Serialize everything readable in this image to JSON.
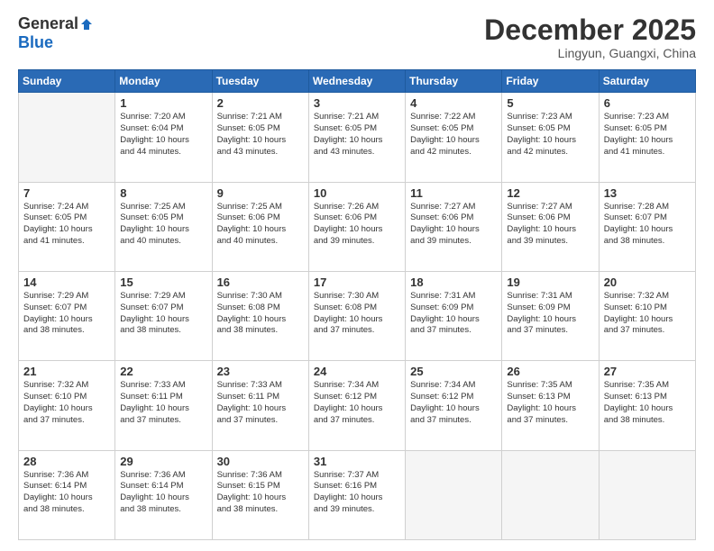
{
  "header": {
    "logo_general": "General",
    "logo_blue": "Blue",
    "month": "December 2025",
    "location": "Lingyun, Guangxi, China"
  },
  "weekdays": [
    "Sunday",
    "Monday",
    "Tuesday",
    "Wednesday",
    "Thursday",
    "Friday",
    "Saturday"
  ],
  "weeks": [
    [
      {
        "day": "",
        "info": ""
      },
      {
        "day": "1",
        "info": "Sunrise: 7:20 AM\nSunset: 6:04 PM\nDaylight: 10 hours\nand 44 minutes."
      },
      {
        "day": "2",
        "info": "Sunrise: 7:21 AM\nSunset: 6:05 PM\nDaylight: 10 hours\nand 43 minutes."
      },
      {
        "day": "3",
        "info": "Sunrise: 7:21 AM\nSunset: 6:05 PM\nDaylight: 10 hours\nand 43 minutes."
      },
      {
        "day": "4",
        "info": "Sunrise: 7:22 AM\nSunset: 6:05 PM\nDaylight: 10 hours\nand 42 minutes."
      },
      {
        "day": "5",
        "info": "Sunrise: 7:23 AM\nSunset: 6:05 PM\nDaylight: 10 hours\nand 42 minutes."
      },
      {
        "day": "6",
        "info": "Sunrise: 7:23 AM\nSunset: 6:05 PM\nDaylight: 10 hours\nand 41 minutes."
      }
    ],
    [
      {
        "day": "7",
        "info": "Sunrise: 7:24 AM\nSunset: 6:05 PM\nDaylight: 10 hours\nand 41 minutes."
      },
      {
        "day": "8",
        "info": "Sunrise: 7:25 AM\nSunset: 6:05 PM\nDaylight: 10 hours\nand 40 minutes."
      },
      {
        "day": "9",
        "info": "Sunrise: 7:25 AM\nSunset: 6:06 PM\nDaylight: 10 hours\nand 40 minutes."
      },
      {
        "day": "10",
        "info": "Sunrise: 7:26 AM\nSunset: 6:06 PM\nDaylight: 10 hours\nand 39 minutes."
      },
      {
        "day": "11",
        "info": "Sunrise: 7:27 AM\nSunset: 6:06 PM\nDaylight: 10 hours\nand 39 minutes."
      },
      {
        "day": "12",
        "info": "Sunrise: 7:27 AM\nSunset: 6:06 PM\nDaylight: 10 hours\nand 39 minutes."
      },
      {
        "day": "13",
        "info": "Sunrise: 7:28 AM\nSunset: 6:07 PM\nDaylight: 10 hours\nand 38 minutes."
      }
    ],
    [
      {
        "day": "14",
        "info": "Sunrise: 7:29 AM\nSunset: 6:07 PM\nDaylight: 10 hours\nand 38 minutes."
      },
      {
        "day": "15",
        "info": "Sunrise: 7:29 AM\nSunset: 6:07 PM\nDaylight: 10 hours\nand 38 minutes."
      },
      {
        "day": "16",
        "info": "Sunrise: 7:30 AM\nSunset: 6:08 PM\nDaylight: 10 hours\nand 38 minutes."
      },
      {
        "day": "17",
        "info": "Sunrise: 7:30 AM\nSunset: 6:08 PM\nDaylight: 10 hours\nand 37 minutes."
      },
      {
        "day": "18",
        "info": "Sunrise: 7:31 AM\nSunset: 6:09 PM\nDaylight: 10 hours\nand 37 minutes."
      },
      {
        "day": "19",
        "info": "Sunrise: 7:31 AM\nSunset: 6:09 PM\nDaylight: 10 hours\nand 37 minutes."
      },
      {
        "day": "20",
        "info": "Sunrise: 7:32 AM\nSunset: 6:10 PM\nDaylight: 10 hours\nand 37 minutes."
      }
    ],
    [
      {
        "day": "21",
        "info": "Sunrise: 7:32 AM\nSunset: 6:10 PM\nDaylight: 10 hours\nand 37 minutes."
      },
      {
        "day": "22",
        "info": "Sunrise: 7:33 AM\nSunset: 6:11 PM\nDaylight: 10 hours\nand 37 minutes."
      },
      {
        "day": "23",
        "info": "Sunrise: 7:33 AM\nSunset: 6:11 PM\nDaylight: 10 hours\nand 37 minutes."
      },
      {
        "day": "24",
        "info": "Sunrise: 7:34 AM\nSunset: 6:12 PM\nDaylight: 10 hours\nand 37 minutes."
      },
      {
        "day": "25",
        "info": "Sunrise: 7:34 AM\nSunset: 6:12 PM\nDaylight: 10 hours\nand 37 minutes."
      },
      {
        "day": "26",
        "info": "Sunrise: 7:35 AM\nSunset: 6:13 PM\nDaylight: 10 hours\nand 37 minutes."
      },
      {
        "day": "27",
        "info": "Sunrise: 7:35 AM\nSunset: 6:13 PM\nDaylight: 10 hours\nand 38 minutes."
      }
    ],
    [
      {
        "day": "28",
        "info": "Sunrise: 7:36 AM\nSunset: 6:14 PM\nDaylight: 10 hours\nand 38 minutes."
      },
      {
        "day": "29",
        "info": "Sunrise: 7:36 AM\nSunset: 6:14 PM\nDaylight: 10 hours\nand 38 minutes."
      },
      {
        "day": "30",
        "info": "Sunrise: 7:36 AM\nSunset: 6:15 PM\nDaylight: 10 hours\nand 38 minutes."
      },
      {
        "day": "31",
        "info": "Sunrise: 7:37 AM\nSunset: 6:16 PM\nDaylight: 10 hours\nand 39 minutes."
      },
      {
        "day": "",
        "info": ""
      },
      {
        "day": "",
        "info": ""
      },
      {
        "day": "",
        "info": ""
      }
    ]
  ]
}
